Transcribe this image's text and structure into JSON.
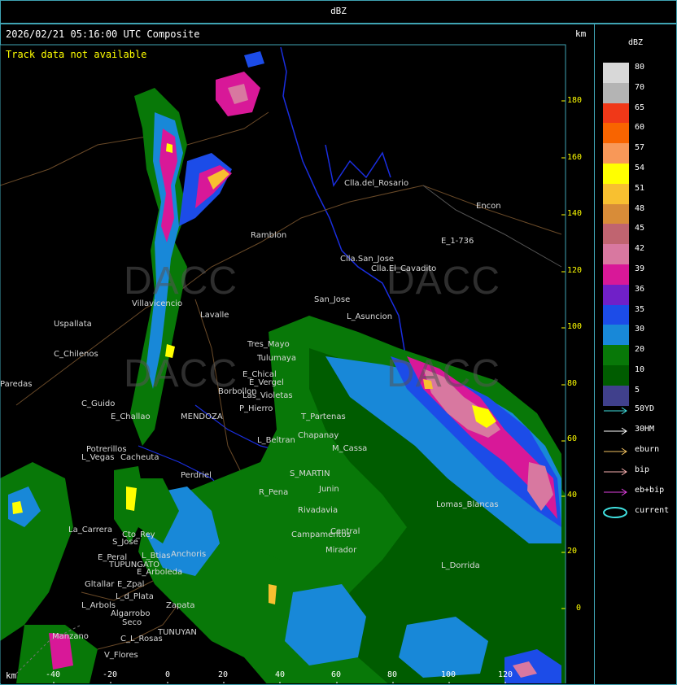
{
  "window": {
    "title": "dBZ"
  },
  "header": {
    "timestamp": "2026/02/21 05:16:00 UTC Composite",
    "track_note": "Track data not available",
    "km_unit": "km"
  },
  "axes": {
    "y_ticks": [
      "180",
      "160",
      "140",
      "120",
      "100",
      "80",
      "60",
      "40",
      "20",
      "0"
    ],
    "x_ticks": [
      "-40",
      "-20",
      "0",
      "20",
      "40",
      "60",
      "80",
      "100",
      "120"
    ],
    "x_unit": "km"
  },
  "legend": {
    "title": "dBZ",
    "levels": [
      {
        "label": "80",
        "color": "#d8d8d8"
      },
      {
        "label": "70",
        "color": "#b4b4b4"
      },
      {
        "label": "65",
        "color": "#f03818"
      },
      {
        "label": "60",
        "color": "#f86400"
      },
      {
        "label": "57",
        "color": "#f89858"
      },
      {
        "label": "54",
        "color": "#ffff00"
      },
      {
        "label": "51",
        "color": "#f8c030"
      },
      {
        "label": "48",
        "color": "#d88c38"
      },
      {
        "label": "45",
        "color": "#c06470"
      },
      {
        "label": "42",
        "color": "#d878a0"
      },
      {
        "label": "39",
        "color": "#d81898"
      },
      {
        "label": "36",
        "color": "#7020c8"
      },
      {
        "label": "35",
        "color": "#1c4ce8"
      },
      {
        "label": "30",
        "color": "#1888d8"
      },
      {
        "label": "20",
        "color": "#087808"
      },
      {
        "label": "10",
        "color": "#005c00"
      },
      {
        "label": "5",
        "color": "#40408c"
      }
    ],
    "tracks": [
      {
        "label": "50YD",
        "color": "#40e0e0"
      },
      {
        "label": "30HM",
        "color": "#ffffff"
      },
      {
        "label": "eburn",
        "color": "#f0c060"
      },
      {
        "label": "bip",
        "color": "#f8b0b0"
      },
      {
        "label": "eb+bip",
        "color": "#e040e0"
      },
      {
        "label": "current",
        "color": "#40e0e0"
      }
    ]
  },
  "places": [
    "Clla.del_Rosario",
    "Encon",
    "E_1-736",
    "Ramblon",
    "Clla.San_Jose",
    "Clla.El_Cavadito",
    "Villavicencio",
    "Lavalle",
    "Uspallata",
    "C_Chilenos",
    "San_Jose",
    "L_Asuncion",
    "Tres_Mayo",
    "Tulumaya",
    "E_Chical",
    "E_Vergel",
    "Borbollon",
    "Las_Violetas",
    "P_Hierro",
    "C_Guido",
    "E_Challao",
    "MENDOZA",
    "T_Partenas",
    "L_Beltran",
    "Chapanay",
    "Potrerillos",
    "L_Vegas",
    "Cacheuta",
    "Perdriel",
    "S_MARTIN",
    "M_Cassa",
    "R_Pena",
    "Junin",
    "Rivadavia",
    "Lomas_Blancas",
    "La_Carrera",
    "Cto_Rey",
    "S_Jose",
    "E_Peral",
    "TUPUNGATO",
    "Anchoris",
    "L_Btias",
    "Campamentos",
    "Central",
    "Mirador",
    "E_Arboleda",
    "E_Zpal",
    "Gltallar",
    "L_d_Plata",
    "Zapata",
    "L_Arbols",
    "Algarrobo",
    "Seco",
    "C_L_Rosas",
    "TUNUYAN",
    "V_Flores",
    "Manzano",
    "L_Dorrida",
    "Paredas"
  ],
  "watermark": {
    "text": "DACC"
  }
}
